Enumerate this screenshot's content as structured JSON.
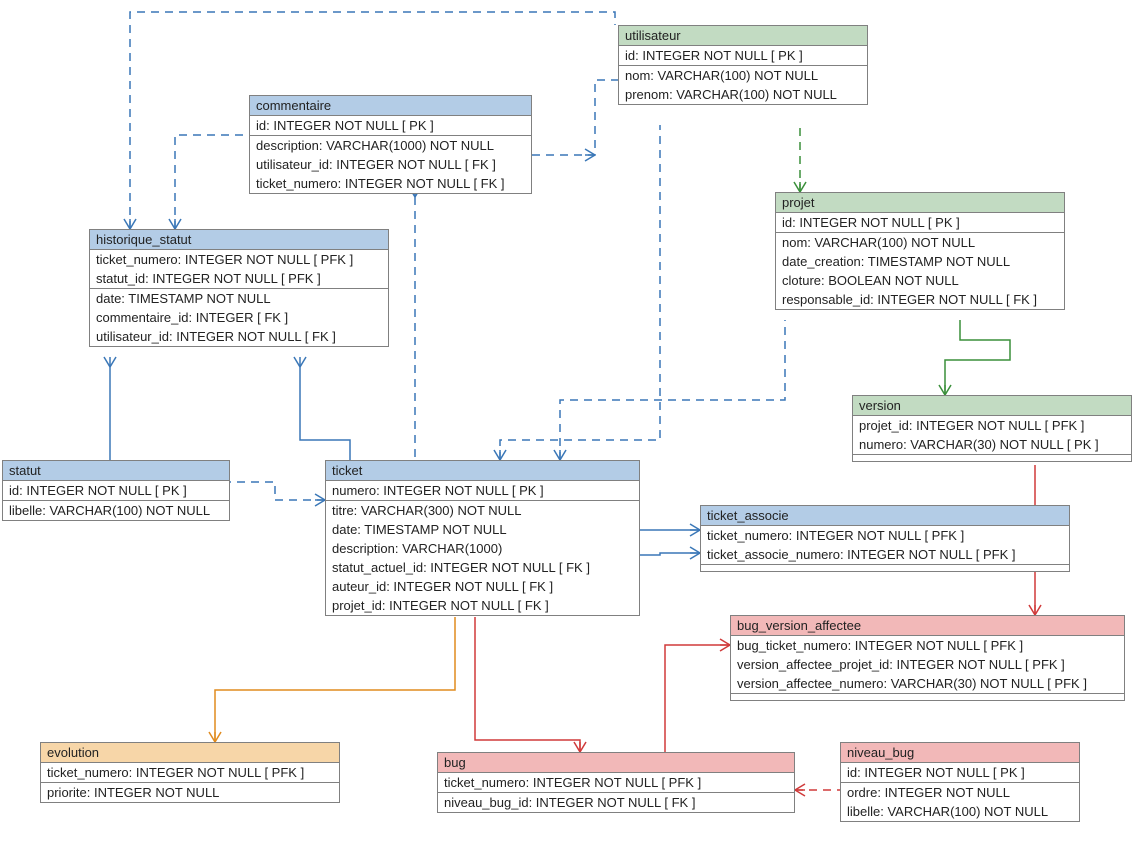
{
  "entities": {
    "utilisateur": {
      "title": "utilisateur",
      "pk": [
        "id: INTEGER   NOT NULL  [ PK ]"
      ],
      "attrs": [
        "nom: VARCHAR(100)   NOT NULL",
        "prenom: VARCHAR(100)   NOT NULL"
      ]
    },
    "commentaire": {
      "title": "commentaire",
      "pk": [
        "id: INTEGER   NOT NULL  [ PK ]"
      ],
      "attrs": [
        "description: VARCHAR(1000)   NOT NULL",
        "utilisateur_id: INTEGER   NOT NULL  [ FK ]",
        "ticket_numero: INTEGER   NOT NULL  [ FK ]"
      ]
    },
    "projet": {
      "title": "projet",
      "pk": [
        "id: INTEGER   NOT NULL  [ PK ]"
      ],
      "attrs": [
        "nom: VARCHAR(100)   NOT NULL",
        "date_creation: TIMESTAMP   NOT NULL",
        "cloture: BOOLEAN   NOT NULL",
        "responsable_id: INTEGER   NOT NULL  [ FK ]"
      ]
    },
    "historique_statut": {
      "title": "historique_statut",
      "pk": [
        "ticket_numero: INTEGER   NOT NULL  [ PFK ]",
        "statut_id: INTEGER   NOT NULL  [ PFK ]"
      ],
      "attrs": [
        "date: TIMESTAMP   NOT NULL",
        "commentaire_id: INTEGER  [ FK ]",
        "utilisateur_id: INTEGER   NOT NULL  [ FK ]"
      ]
    },
    "version": {
      "title": "version",
      "pk": [
        "projet_id: INTEGER   NOT NULL  [ PFK ]",
        "numero: VARCHAR(30)   NOT NULL  [ PK ]"
      ],
      "attrs": []
    },
    "statut": {
      "title": "statut",
      "pk": [
        "id: INTEGER   NOT NULL  [ PK ]"
      ],
      "attrs": [
        "libelle: VARCHAR(100)   NOT NULL"
      ]
    },
    "ticket": {
      "title": "ticket",
      "pk": [
        "numero: INTEGER   NOT NULL  [ PK ]"
      ],
      "attrs": [
        "titre: VARCHAR(300)   NOT NULL",
        "date: TIMESTAMP   NOT NULL",
        "description: VARCHAR(1000)",
        "statut_actuel_id: INTEGER   NOT NULL  [ FK ]",
        "auteur_id: INTEGER   NOT NULL  [ FK ]",
        "projet_id: INTEGER   NOT NULL  [ FK ]"
      ]
    },
    "ticket_associe": {
      "title": "ticket_associe",
      "pk": [
        "ticket_numero: INTEGER   NOT NULL  [ PFK ]",
        "ticket_associe_numero: INTEGER   NOT NULL  [ PFK ]"
      ],
      "attrs": []
    },
    "bug_version_affectee": {
      "title": "bug_version_affectee",
      "pk": [
        "bug_ticket_numero: INTEGER   NOT NULL  [ PFK ]",
        "version_affectee_projet_id: INTEGER   NOT NULL  [ PFK ]",
        "version_affectee_numero: VARCHAR(30)   NOT NULL  [ PFK ]"
      ],
      "attrs": []
    },
    "evolution": {
      "title": "evolution",
      "pk": [
        "ticket_numero: INTEGER   NOT NULL  [ PFK ]"
      ],
      "attrs": [
        "priorite: INTEGER   NOT NULL"
      ]
    },
    "bug": {
      "title": "bug",
      "pk": [
        "ticket_numero: INTEGER   NOT NULL  [ PFK ]"
      ],
      "attrs": [
        "niveau_bug_id: INTEGER   NOT NULL  [ FK ]"
      ]
    },
    "niveau_bug": {
      "title": "niveau_bug",
      "pk": [
        "id: INTEGER   NOT NULL  [ PK ]"
      ],
      "attrs": [
        "ordre: INTEGER   NOT NULL",
        "libelle: VARCHAR(100)   NOT NULL"
      ]
    }
  },
  "colors": {
    "blue": "#b3cce6",
    "green": "#c2dbc2",
    "orange": "#f7d6a8",
    "red": "#f2b8b8",
    "line_blue": "#3a77b7",
    "line_green": "#3a8f3a",
    "line_orange": "#e08b1f",
    "line_red": "#d03a3a"
  },
  "relationships": [
    {
      "from": "commentaire",
      "to": "utilisateur",
      "color": "blue",
      "style": "dashed"
    },
    {
      "from": "commentaire",
      "to": "ticket",
      "color": "blue",
      "style": "dashed"
    },
    {
      "from": "historique_statut",
      "to": "commentaire",
      "color": "blue",
      "style": "dashed"
    },
    {
      "from": "historique_statut",
      "to": "utilisateur",
      "color": "blue",
      "style": "dashed"
    },
    {
      "from": "historique_statut",
      "to": "ticket",
      "color": "blue",
      "style": "solid"
    },
    {
      "from": "historique_statut",
      "to": "statut",
      "color": "blue",
      "style": "solid"
    },
    {
      "from": "projet",
      "to": "utilisateur",
      "color": "green",
      "style": "dashed"
    },
    {
      "from": "version",
      "to": "projet",
      "color": "green",
      "style": "solid"
    },
    {
      "from": "ticket",
      "to": "utilisateur",
      "color": "blue",
      "style": "dashed"
    },
    {
      "from": "ticket",
      "to": "statut",
      "color": "blue",
      "style": "dashed"
    },
    {
      "from": "ticket",
      "to": "projet",
      "color": "blue",
      "style": "dashed"
    },
    {
      "from": "ticket_associe",
      "to": "ticket",
      "color": "blue",
      "style": "solid"
    },
    {
      "from": "ticket_associe",
      "to": "ticket",
      "color": "blue",
      "style": "solid"
    },
    {
      "from": "bug_version_affectee",
      "to": "version",
      "color": "red",
      "style": "solid"
    },
    {
      "from": "bug_version_affectee",
      "to": "bug",
      "color": "red",
      "style": "solid"
    },
    {
      "from": "evolution",
      "to": "ticket",
      "color": "orange",
      "style": "solid"
    },
    {
      "from": "bug",
      "to": "ticket",
      "color": "red",
      "style": "solid"
    },
    {
      "from": "bug",
      "to": "niveau_bug",
      "color": "red",
      "style": "dashed"
    }
  ]
}
